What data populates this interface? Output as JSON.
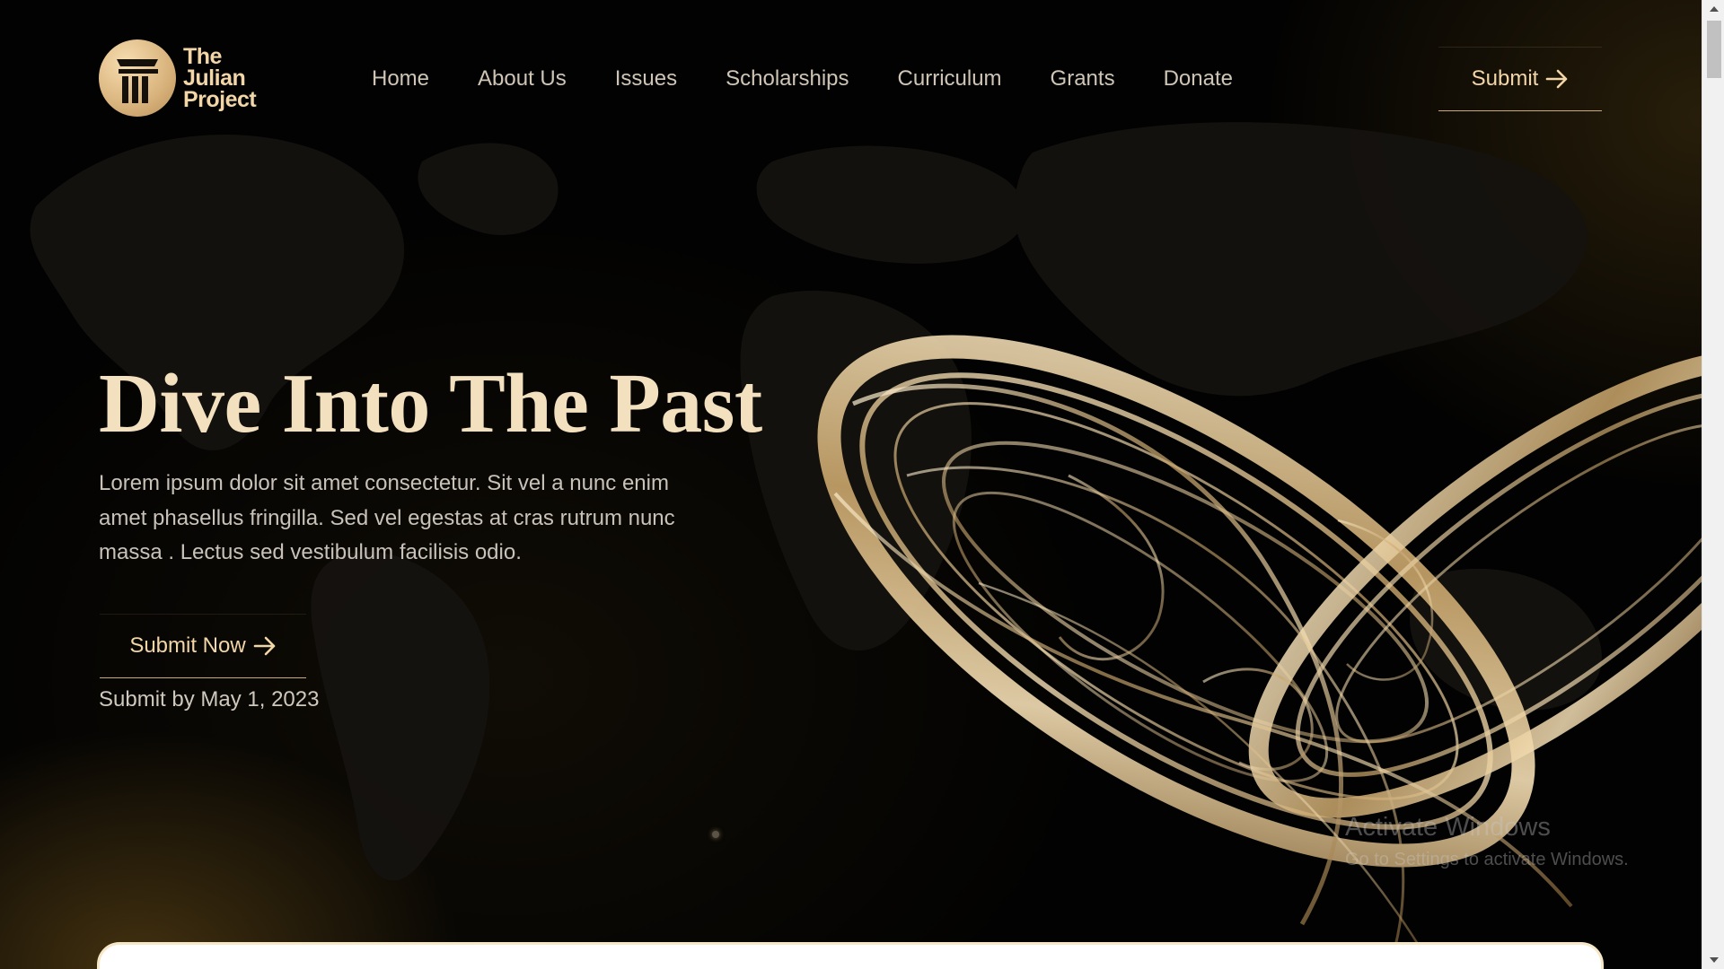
{
  "brand": {
    "name_line1": "The",
    "name_line2": "Julian",
    "name_line3": "Project",
    "icon": "pillar-icon"
  },
  "nav": {
    "items": [
      {
        "label": "Home"
      },
      {
        "label": "About Us"
      },
      {
        "label": "Issues"
      },
      {
        "label": "Scholarships"
      },
      {
        "label": "Curriculum"
      },
      {
        "label": "Grants"
      },
      {
        "label": "Donate"
      }
    ]
  },
  "header": {
    "submit_label": "Submit",
    "submit_icon": "arrow-right-icon"
  },
  "hero": {
    "title": "Dive Into The Past",
    "description": "Lorem ipsum dolor sit amet consectetur. Sit vel a nunc enim amet phasellus fringilla. Sed vel egestas at cras rutrum nunc massa . Lectus sed vestibulum facilisis odio.",
    "cta_label": "Submit Now",
    "cta_icon": "arrow-right-icon",
    "deadline": "Submit by May 1, 2023"
  },
  "watermark": {
    "line1": "Activate Windows",
    "line2": "Go to Settings to activate Windows."
  },
  "colors": {
    "accent_gold": "#f2d6a8",
    "title_cream": "#f3e0be",
    "background": "#020202",
    "nav_text": "#cfc5b6"
  }
}
